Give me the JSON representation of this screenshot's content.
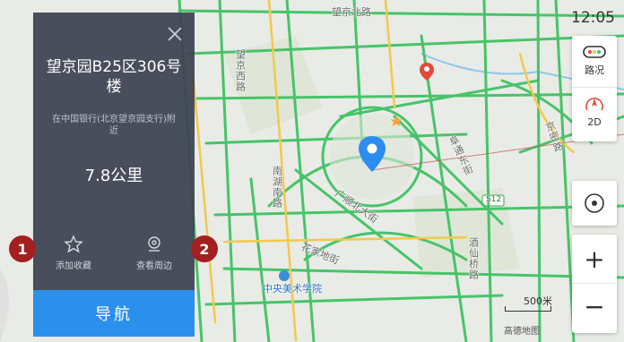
{
  "map": {
    "labels": {
      "wangjing_north_road": "望京北路",
      "wangjing_west_road": "望京西路",
      "nanhu_south_road": "南湖南路",
      "guangshun_north_street": "广顺北大街",
      "huajiadi_street": "花家地街",
      "futong_east_street": "阜通东街",
      "jiuxianqiao_road": "酒仙桥路",
      "jingmi_road": "京密路",
      "art_academy": "中央美术学院",
      "highway_tag": "S12"
    },
    "scale_label": "500米",
    "brand": "高德地图"
  },
  "status_bar": {
    "time": "12:05"
  },
  "poi_panel": {
    "title": "望京园B25区306号楼",
    "subtitle": "在中国银行(北京望京园支行)附近",
    "distance": "7.8公里",
    "actions": [
      {
        "label": "添加收藏",
        "icon": "star-icon"
      },
      {
        "label": "查看周边",
        "icon": "nearby-pin-icon"
      }
    ],
    "navigate_label": "导航"
  },
  "map_controls": {
    "traffic_label": "路况",
    "view_mode_label": "2D",
    "zoom_in": "+",
    "zoom_out": "−"
  },
  "annotations": {
    "badge_1": "1",
    "badge_2": "2"
  },
  "colors": {
    "road_green": "#47c46a",
    "road_yellow": "#f2c94c",
    "panel_bg": "#3c4252",
    "nav_blue": "#2a90ec",
    "badge_red": "#a31f20",
    "pin_blue": "#2d8cf0"
  }
}
